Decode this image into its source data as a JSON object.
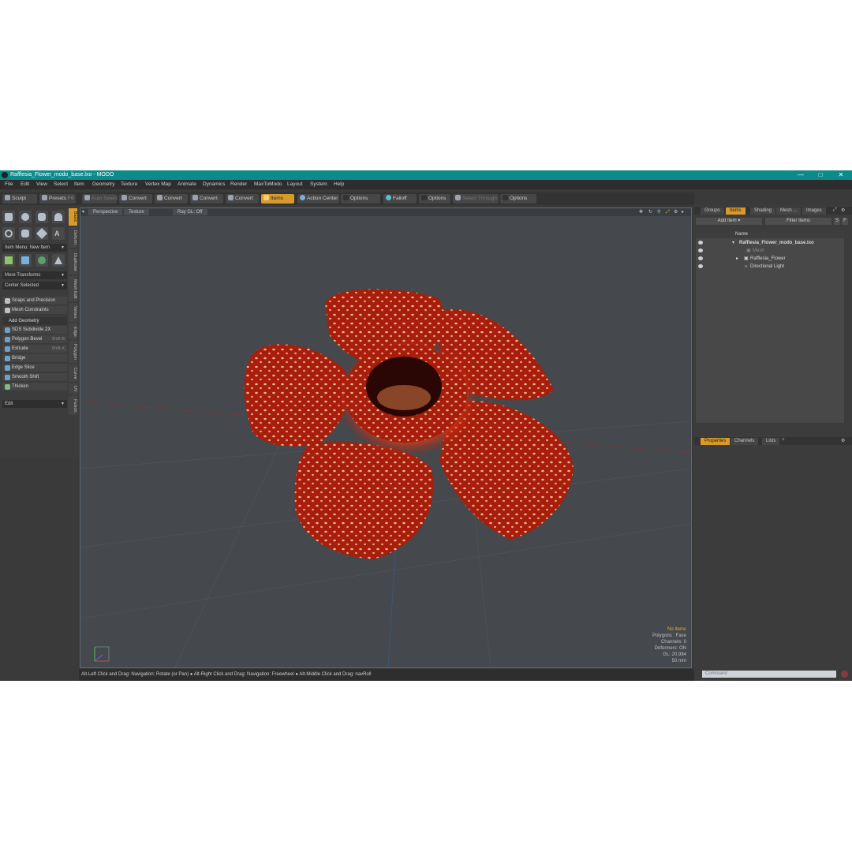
{
  "window": {
    "title": "Rafflesia_Flower_modo_base.lxo - MODO"
  },
  "menu": [
    "File",
    "Edit",
    "View",
    "Select",
    "Item",
    "Geometry",
    "Texture",
    "Vertex Map",
    "Animate",
    "Dynamics",
    "Render",
    "MaxToModo",
    "Layout",
    "System",
    "Help"
  ],
  "toolbar": {
    "sculpt": "Sculpt",
    "presets": "Presets",
    "presets_key": "F6",
    "auto_select": "Auto Select",
    "convert1": "Convert",
    "convert2": "Convert",
    "convert3": "Convert",
    "convert4": "Convert",
    "items": "Items",
    "action_center": "Action Center",
    "options1": "Options",
    "falloff": "Falloff",
    "options2": "Options",
    "select_through": "Select Through",
    "options3": "Options"
  },
  "left_panel": {
    "item_menu": "Item Menu: New Item",
    "more_transforms": "More Transforms",
    "center_selected": "Center Selected",
    "snaps": "Snaps and Precision",
    "mesh_constraints": "Mesh Constraints",
    "add_geometry": "Add Geometry",
    "tools": [
      {
        "label": "SDS Subdivide 2X",
        "shortcut": ""
      },
      {
        "label": "Polygon Bevel",
        "shortcut": "Shift-B"
      },
      {
        "label": "Extrude",
        "shortcut": "Shift-X"
      },
      {
        "label": "Bridge",
        "shortcut": ""
      },
      {
        "label": "Edge Slice",
        "shortcut": ""
      },
      {
        "label": "Smooth Shift",
        "shortcut": ""
      },
      {
        "label": "Thicken",
        "shortcut": ""
      }
    ],
    "edit": "Edit"
  },
  "vertical_tabs": [
    "Basic",
    "Deform",
    "Duplicate",
    "Mesh Edit",
    "Vertex",
    "Edge",
    "Polygon",
    "Curve",
    "UV",
    "Fusion"
  ],
  "viewport": {
    "perspective": "Perspective",
    "texture": "Texture",
    "ray_gl": "Ray GL: Off",
    "stats": {
      "no_items": "No Items",
      "polygons": "Polygons : Face",
      "channels": "Channels: 0",
      "deformers": "Deformers: ON",
      "gl": "GL: 20,984",
      "lens": "50 mm"
    }
  },
  "status": "Alt-Left Click and Drag: Navigation: Rotate (or Pan) ● Alt-Right Click and Drag: Navigation: Freewheel ● Alt-Middle Click and Drag: navRoll",
  "right_panel": {
    "tabs": [
      "Groups",
      "Items",
      "Shading",
      "Mesh ...",
      "Images"
    ],
    "add_item": "Add Item",
    "filter_items": "Filter Items",
    "filter_s": "S",
    "filter_f": "F",
    "name_col": "Name",
    "tree": [
      {
        "label": "Rafflesia_Flower_modo_base.lxo"
      },
      {
        "label": "Mesh"
      },
      {
        "label": "Rafflesia_Flower"
      },
      {
        "label": "Directional Light"
      }
    ],
    "prop_tabs": [
      "Properties",
      "Channels",
      "Lists"
    ],
    "command_placeholder": "Command"
  },
  "colors": {
    "title_bar": "#0d8a8a",
    "accent": "#d89a2a",
    "flower_red": "#b0200e",
    "flower_spot": "#e8b890"
  }
}
